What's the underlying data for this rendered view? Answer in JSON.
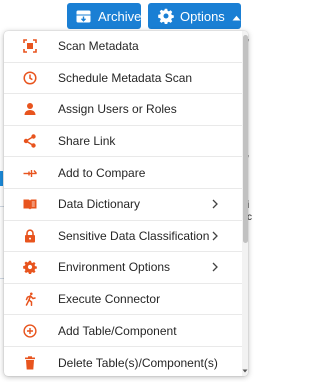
{
  "toolbar": {
    "archives_label": "Archives",
    "options_label": "Options"
  },
  "menu": {
    "items": [
      {
        "label": "Scan Metadata",
        "icon": "scan-icon",
        "has_submenu": false
      },
      {
        "label": "Schedule Metadata Scan",
        "icon": "clock-icon",
        "has_submenu": false
      },
      {
        "label": "Assign Users or Roles",
        "icon": "user-icon",
        "has_submenu": false
      },
      {
        "label": "Share Link",
        "icon": "share-icon",
        "has_submenu": false
      },
      {
        "label": "Add to Compare",
        "icon": "compare-icon",
        "has_submenu": false
      },
      {
        "label": "Data Dictionary",
        "icon": "book-icon",
        "has_submenu": true
      },
      {
        "label": "Sensitive Data Classification",
        "icon": "lock-icon",
        "has_submenu": true
      },
      {
        "label": "Environment Options",
        "icon": "gear-icon",
        "has_submenu": true
      },
      {
        "label": "Execute Connector",
        "icon": "run-icon",
        "has_submenu": false
      },
      {
        "label": "Add Table/Component",
        "icon": "add-circle-icon",
        "has_submenu": false
      },
      {
        "label": "Delete Table(s)/Component(s)",
        "icon": "trash-icon",
        "has_submenu": false
      }
    ]
  },
  "colors": {
    "accent": "#1a7fd4",
    "menu_icon": "#e8541e"
  }
}
